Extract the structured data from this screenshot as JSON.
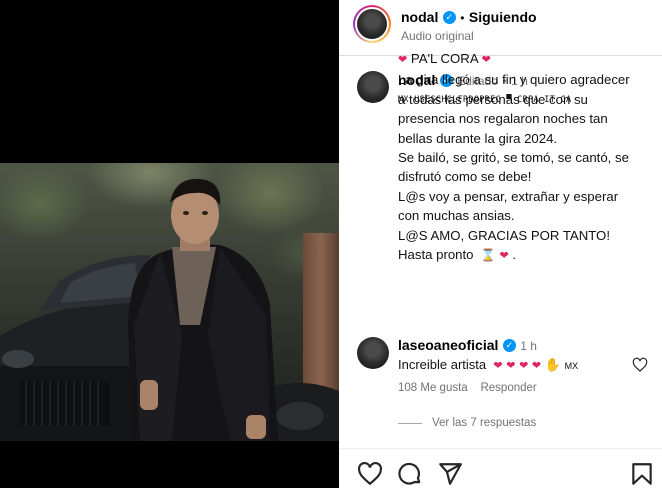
{
  "post": {
    "author": "nodal",
    "follow_separator": "•",
    "follow_status": "Siguiendo",
    "audio": "Audio original"
  },
  "caption": {
    "author": "nodal",
    "edited": "Editado",
    "separator": "•",
    "time": "1 h",
    "mentions": "MX USESCHCLFRDOPREC ▀ CRPA IT CA",
    "lines": [
      "PA'L CORA",
      "La gira llegó a su fin y quiero agradecer",
      "a todas las personas que con su",
      "presencia nos regalaron noches tan",
      "bellas durante la gira 2024.",
      "Se bailó, se gritó, se tomó, se cantó, se",
      "disfrutó como se debe!",
      "L@s voy a pensar, extrañar y esperar",
      "con muchas ansias.",
      "L@S AMO, GRACIAS POR TANTO!",
      "Hasta pronto"
    ],
    "end_punct": "."
  },
  "comment": {
    "author": "laseoaneoficial",
    "time": "1 h",
    "text": "Increible artista",
    "flag": "MX",
    "likes": "108 Me gusta",
    "reply": "Responder",
    "view_replies": "Ver las 7 respuestas"
  },
  "icons": {
    "like": "heart-outline-icon",
    "comment": "comment-icon",
    "share": "share-icon",
    "save": "bookmark-icon"
  },
  "colors": {
    "verified": "#0095f6",
    "heart": "#e0245e",
    "muted": "#737373"
  }
}
